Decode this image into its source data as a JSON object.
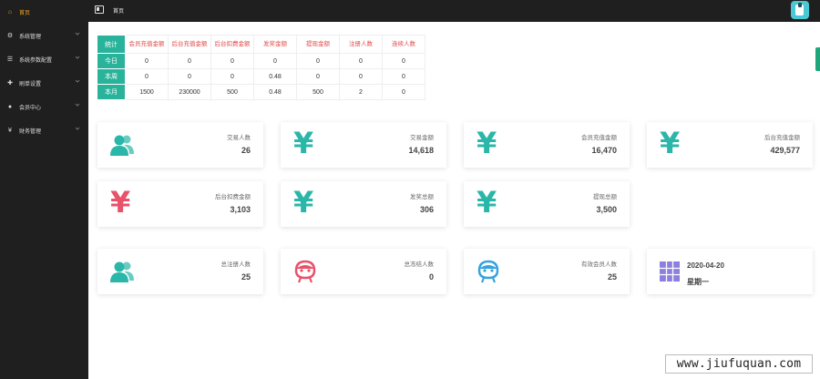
{
  "sidebar": {
    "items": [
      {
        "label": "首页",
        "icon": "home-icon",
        "active": true
      },
      {
        "label": "系统管理",
        "icon": "gear-icon"
      },
      {
        "label": "系统参数配置",
        "icon": "list-icon"
      },
      {
        "label": "刷单设置",
        "icon": "plus-icon"
      },
      {
        "label": "会员中心",
        "icon": "user-icon"
      },
      {
        "label": "财务管理",
        "icon": "yen-icon"
      }
    ]
  },
  "topbar": {
    "title": "首页"
  },
  "stats_table": {
    "corner": "统计",
    "columns": [
      "会员充值金额",
      "后台充值金额",
      "后台扣费金额",
      "发奖金额",
      "提现金额",
      "注册人数",
      "连续人数"
    ],
    "rows": [
      {
        "label": "今日",
        "values": [
          "0",
          "0",
          "0",
          "0",
          "0",
          "0",
          "0"
        ]
      },
      {
        "label": "本周",
        "values": [
          "0",
          "0",
          "0",
          "0.48",
          "0",
          "0",
          "0"
        ]
      },
      {
        "label": "本月",
        "values": [
          "1500",
          "230000",
          "500",
          "0.48",
          "500",
          "2",
          "0"
        ]
      }
    ]
  },
  "cards": [
    {
      "label": "交易人数",
      "value": "26",
      "icon": "users-icon",
      "color": "#2ab7a9"
    },
    {
      "label": "交易金额",
      "value": "14,618",
      "icon": "yen-icon",
      "color": "#2ab7a9"
    },
    {
      "label": "会员充值金额",
      "value": "16,470",
      "icon": "yen-icon",
      "color": "#2ab7a9"
    },
    {
      "label": "后台充值金额",
      "value": "429,577",
      "icon": "yen-icon",
      "color": "#2ab7a9"
    },
    {
      "label": "后台扣费金额",
      "value": "3,103",
      "icon": "yen-icon",
      "color": "#e8526a"
    },
    {
      "label": "发奖总额",
      "value": "306",
      "icon": "yen-icon",
      "color": "#2ab7a9"
    },
    {
      "label": "提现总额",
      "value": "3,500",
      "icon": "yen-icon",
      "color": "#2ab7a9"
    },
    {
      "label": "总注册人数",
      "value": "25",
      "icon": "users-icon",
      "color": "#2ab7a9"
    },
    {
      "label": "总冻结人数",
      "value": "0",
      "icon": "face-icon",
      "color": "#e8526a"
    },
    {
      "label": "有效会员人数",
      "value": "25",
      "icon": "face-icon",
      "color": "#36a2e0"
    }
  ],
  "date_card": {
    "date": "2020-04-20",
    "weekday": "星期一",
    "icon": "calendar-icon",
    "color": "#8b7fe0"
  },
  "watermark": "www.jiufuquan.com"
}
